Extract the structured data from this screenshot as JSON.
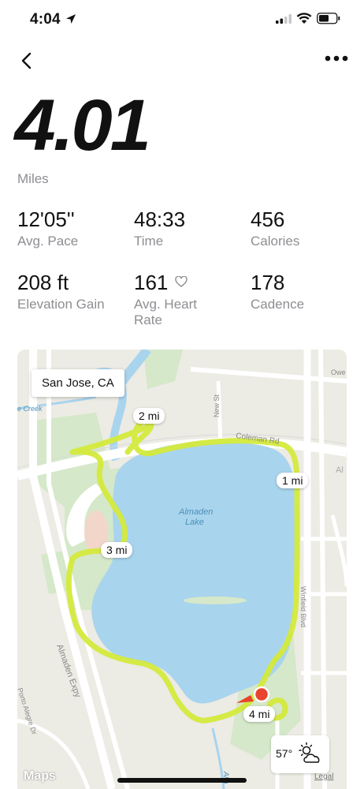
{
  "status_bar": {
    "time": "4:04"
  },
  "workout": {
    "distance": "4.01",
    "distance_unit": "Miles",
    "stats": [
      {
        "value": "12'05''",
        "label": "Avg. Pace"
      },
      {
        "value": "48:33",
        "label": "Time"
      },
      {
        "value": "456",
        "label": "Calories"
      },
      {
        "value": "208 ft",
        "label": "Elevation Gain"
      },
      {
        "value": "161",
        "label": "Avg. Heart Rate"
      },
      {
        "value": "178",
        "label": "Cadence"
      }
    ]
  },
  "map": {
    "location": "San Jose, CA",
    "lake_label_line1": "Almaden",
    "lake_label_line2": "Lake",
    "road_coleman": "Coleman Rd",
    "road_new_st": "New St",
    "road_winfield": "Winfield Blvd",
    "road_almaden_expy": "Almaden Expy",
    "road_porto_alegre": "Porto Alegre Dr",
    "road_owen": "Owe",
    "creek": "e Creek",
    "road_al": "Al",
    "road_alm": "Alm",
    "mile_markers": [
      "1 mi",
      "2 mi",
      "3 mi",
      "4 mi"
    ],
    "route_color": "#d4ea3c",
    "water_color": "#a9d4ee"
  },
  "weather": {
    "temp": "57°",
    "icon": "partly-cloudy-icon"
  },
  "maps_brand": "Maps",
  "legal": "Legal"
}
